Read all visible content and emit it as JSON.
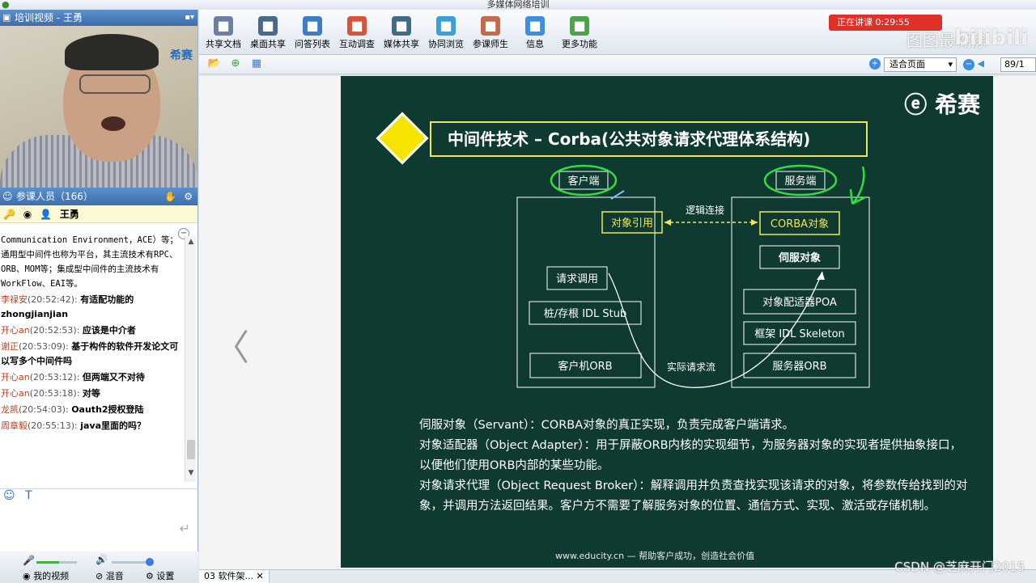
{
  "window": {
    "title": "多媒体网络培训"
  },
  "left": {
    "video_header": "培训视频 - 王勇",
    "video_logo": "希赛",
    "attendees_header": "参课人员（166）",
    "host_name": "王勇",
    "chat_system": "Communication Environment，ACE）等；通用型中间件也称为平台，其主流技术有RPC、ORB、MOM等；集成型中间件的主流技术有WorkFlow、EAI等。",
    "chat": [
      {
        "who": "李禄安",
        "time": "(20:52:42):",
        "text": "有适配功能的 zhongjianjian"
      },
      {
        "who": "开心an",
        "time": "(20:52:53):",
        "text": "应该是中介者"
      },
      {
        "who": "谢正",
        "time": "(20:53:09):",
        "text": "基于构件的软件开发论文可以写多个中间件吗"
      },
      {
        "who": "开心an",
        "time": "(20:53:12):",
        "text": "但两端又不对待"
      },
      {
        "who": "开心an",
        "time": "(20:53:18):",
        "text": "对等"
      },
      {
        "who": "龙凯",
        "time": "(20:54:03):",
        "text": "Oauth2授权登陆"
      },
      {
        "who": "周章毅",
        "time": "(20:55:13):",
        "text": "java里面的吗？"
      }
    ],
    "bottom": {
      "my_video": "我的视频",
      "mix": "混音",
      "settings": "设置"
    }
  },
  "toolbar": {
    "items": [
      {
        "label": "共享文档",
        "icon": "share-doc-icon",
        "color": "#6a7fa3"
      },
      {
        "label": "桌面共享",
        "icon": "desktop-share-icon",
        "color": "#4a6a8c"
      },
      {
        "label": "问答列表",
        "icon": "qa-list-icon",
        "color": "#3c7dc8"
      },
      {
        "label": "互动调查",
        "icon": "survey-icon",
        "color": "#d8533a"
      },
      {
        "label": "媒体共享",
        "icon": "media-share-icon",
        "color": "#3e6b86"
      },
      {
        "label": "协同浏览",
        "icon": "co-browse-icon",
        "color": "#3aa0d8"
      },
      {
        "label": "参课师生",
        "icon": "attendees-icon",
        "color": "#c26a4a"
      },
      {
        "label": "信息",
        "icon": "info-icon",
        "color": "#3d8de0"
      },
      {
        "label": "更多功能",
        "icon": "more-icon",
        "color": "#4ca34a"
      }
    ],
    "live_label": "正在讲课 0:29:55",
    "watermark": "图图最糊涂",
    "watermark_site": "bilibili"
  },
  "subbar": {
    "zoom_value": "适合页面",
    "page_value": "89/1"
  },
  "slide": {
    "brand": "希赛",
    "title": "中间件技术 – Corba(公共对象请求代理体系结构)",
    "client_label": "客户端",
    "server_label": "服务端",
    "link_label": "逻辑连接",
    "flow_label": "实际请求流",
    "client_boxes": [
      "对象引用",
      "请求调用",
      "桩/存根 IDL Stub",
      "客户机ORB"
    ],
    "server_boxes": [
      "CORBA对象",
      "伺服对象",
      "对象配适器POA",
      "框架 IDL Skeleton",
      "服务器ORB"
    ],
    "descriptions": [
      "伺服对象（Servant）：CORBA对象的真正实现，负责完成客户端请求。",
      "对象适配器（Object Adapter）：用于屏蔽ORB内核的实现细节，为服务器对象的实现者提供抽象接口，以便他们使用ORB内部的某些功能。",
      "对象请求代理（Object Request Broker）：解释调用并负责查找实现该请求的对象，将参数传给找到的对象，并调用方法返回结果。客户方不需要了解服务对象的位置、通信方式、实现、激活或存储机制。"
    ],
    "footer": "www.educity.cn — 帮助客户成功，创造社会价值",
    "accent": "#f5e400",
    "background": "#0f3a31"
  },
  "tabs": [
    "03 软件架..."
  ],
  "overlay": {
    "csdn": "CSDN @芝麻开门2015"
  }
}
